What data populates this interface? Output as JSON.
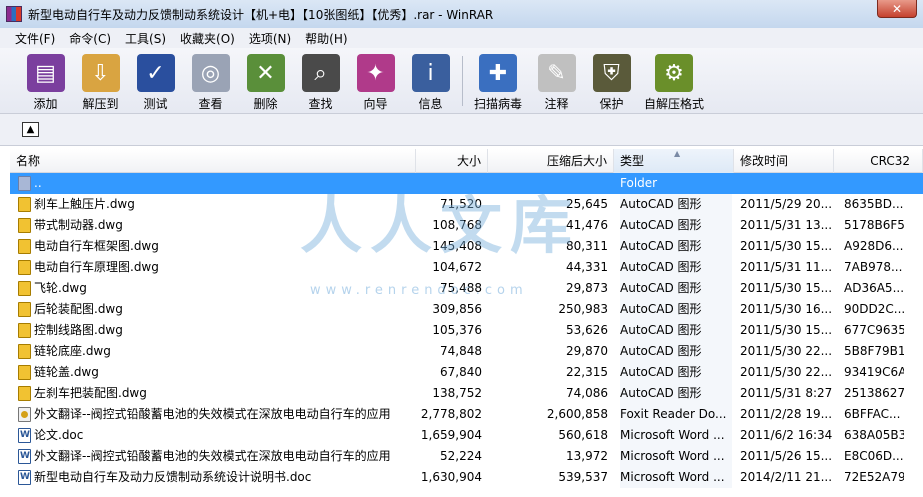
{
  "window": {
    "title": "新型电动自行车及动力反馈制动系统设计【机+电】【10张图纸】【优秀】.rar - WinRAR",
    "close_label": "✕"
  },
  "menu": [
    "文件(F)",
    "命令(C)",
    "工具(S)",
    "收藏夹(O)",
    "选项(N)",
    "帮助(H)"
  ],
  "toolbar": [
    {
      "label": "添加",
      "icon": "add-archive-icon",
      "color": "#7b3f9e"
    },
    {
      "label": "解压到",
      "icon": "extract-to-icon",
      "color": "#d9a441"
    },
    {
      "label": "测试",
      "icon": "test-icon",
      "color": "#2a4f9e"
    },
    {
      "label": "查看",
      "icon": "view-icon",
      "color": "#9aa3b5"
    },
    {
      "label": "删除",
      "icon": "delete-icon",
      "color": "#5a8f3a"
    },
    {
      "label": "查找",
      "icon": "find-icon",
      "color": "#4a4a4a"
    },
    {
      "label": "向导",
      "icon": "wizard-icon",
      "color": "#b03a8a"
    },
    {
      "label": "信息",
      "icon": "info-icon",
      "color": "#3a5f9e"
    },
    {
      "label": "扫描病毒",
      "icon": "virus-scan-icon",
      "color": "#3a6fc0"
    },
    {
      "label": "注释",
      "icon": "comment-icon",
      "color": "#c0c0c0"
    },
    {
      "label": "保护",
      "icon": "protect-icon",
      "color": "#5a5a3a"
    },
    {
      "label": "自解压格式",
      "icon": "sfx-icon",
      "color": "#6a8f2a"
    }
  ],
  "columns": {
    "name": "名称",
    "size": "大小",
    "packed": "压缩后大小",
    "type": "类型",
    "modified": "修改时间",
    "crc": "CRC32"
  },
  "files": [
    {
      "name": "..",
      "size": "",
      "packed": "",
      "type": "Folder",
      "modified": "",
      "crc": "",
      "icon": "folder"
    },
    {
      "name": "刹车上触压片.dwg",
      "size": "71,520",
      "packed": "25,645",
      "type": "AutoCAD 图形",
      "modified": "2011/5/29 20...",
      "crc": "8635BD...",
      "icon": "dwg"
    },
    {
      "name": "带式制动器.dwg",
      "size": "108,768",
      "packed": "41,476",
      "type": "AutoCAD 图形",
      "modified": "2011/5/31 13...",
      "crc": "5178B6F5",
      "icon": "dwg"
    },
    {
      "name": "电动自行车框架图.dwg",
      "size": "145,408",
      "packed": "80,311",
      "type": "AutoCAD 图形",
      "modified": "2011/5/30 15...",
      "crc": "A928D6...",
      "icon": "dwg"
    },
    {
      "name": "电动自行车原理图.dwg",
      "size": "104,672",
      "packed": "44,331",
      "type": "AutoCAD 图形",
      "modified": "2011/5/31 11...",
      "crc": "7AB978...",
      "icon": "dwg"
    },
    {
      "name": "飞轮.dwg",
      "size": "75,488",
      "packed": "29,873",
      "type": "AutoCAD 图形",
      "modified": "2011/5/30 15...",
      "crc": "AD36A5...",
      "icon": "dwg"
    },
    {
      "name": "后轮装配图.dwg",
      "size": "309,856",
      "packed": "250,983",
      "type": "AutoCAD 图形",
      "modified": "2011/5/30 16...",
      "crc": "90DD2C...",
      "icon": "dwg"
    },
    {
      "name": "控制线路图.dwg",
      "size": "105,376",
      "packed": "53,626",
      "type": "AutoCAD 图形",
      "modified": "2011/5/30 15...",
      "crc": "677C9635",
      "icon": "dwg"
    },
    {
      "name": "链轮底座.dwg",
      "size": "74,848",
      "packed": "29,870",
      "type": "AutoCAD 图形",
      "modified": "2011/5/30 22...",
      "crc": "5B8F79B1",
      "icon": "dwg"
    },
    {
      "name": "链轮盖.dwg",
      "size": "67,840",
      "packed": "22,315",
      "type": "AutoCAD 图形",
      "modified": "2011/5/30 22...",
      "crc": "93419C6A",
      "icon": "dwg"
    },
    {
      "name": "左刹车把装配图.dwg",
      "size": "138,752",
      "packed": "74,086",
      "type": "AutoCAD 图形",
      "modified": "2011/5/31 8:27",
      "crc": "25138627",
      "icon": "dwg"
    },
    {
      "name": "外文翻译--阀控式铅酸蓄电池的失效模式在深放电电动自行车的应用",
      "size": "2,778,802",
      "packed": "2,600,858",
      "type": "Foxit Reader Do...",
      "modified": "2011/2/28 19...",
      "crc": "6BFFAC...",
      "icon": "pdf"
    },
    {
      "name": "论文.doc",
      "size": "1,659,904",
      "packed": "560,618",
      "type": "Microsoft Word ...",
      "modified": "2011/6/2 16:34",
      "crc": "638A05B3",
      "icon": "doc"
    },
    {
      "name": "外文翻译--阀控式铅酸蓄电池的失效模式在深放电电动自行车的应用",
      "size": "52,224",
      "packed": "13,972",
      "type": "Microsoft Word ...",
      "modified": "2011/5/26 15...",
      "crc": "E8C06D...",
      "icon": "doc"
    },
    {
      "name": "新型电动自行车及动力反馈制动系统设计说明书.doc",
      "size": "1,630,904",
      "packed": "539,537",
      "type": "Microsoft Word ...",
      "modified": "2014/2/11 21...",
      "crc": "72E52A79",
      "icon": "doc"
    }
  ],
  "watermark": {
    "text": "人人文库",
    "url": "www.renrendoc.com"
  }
}
